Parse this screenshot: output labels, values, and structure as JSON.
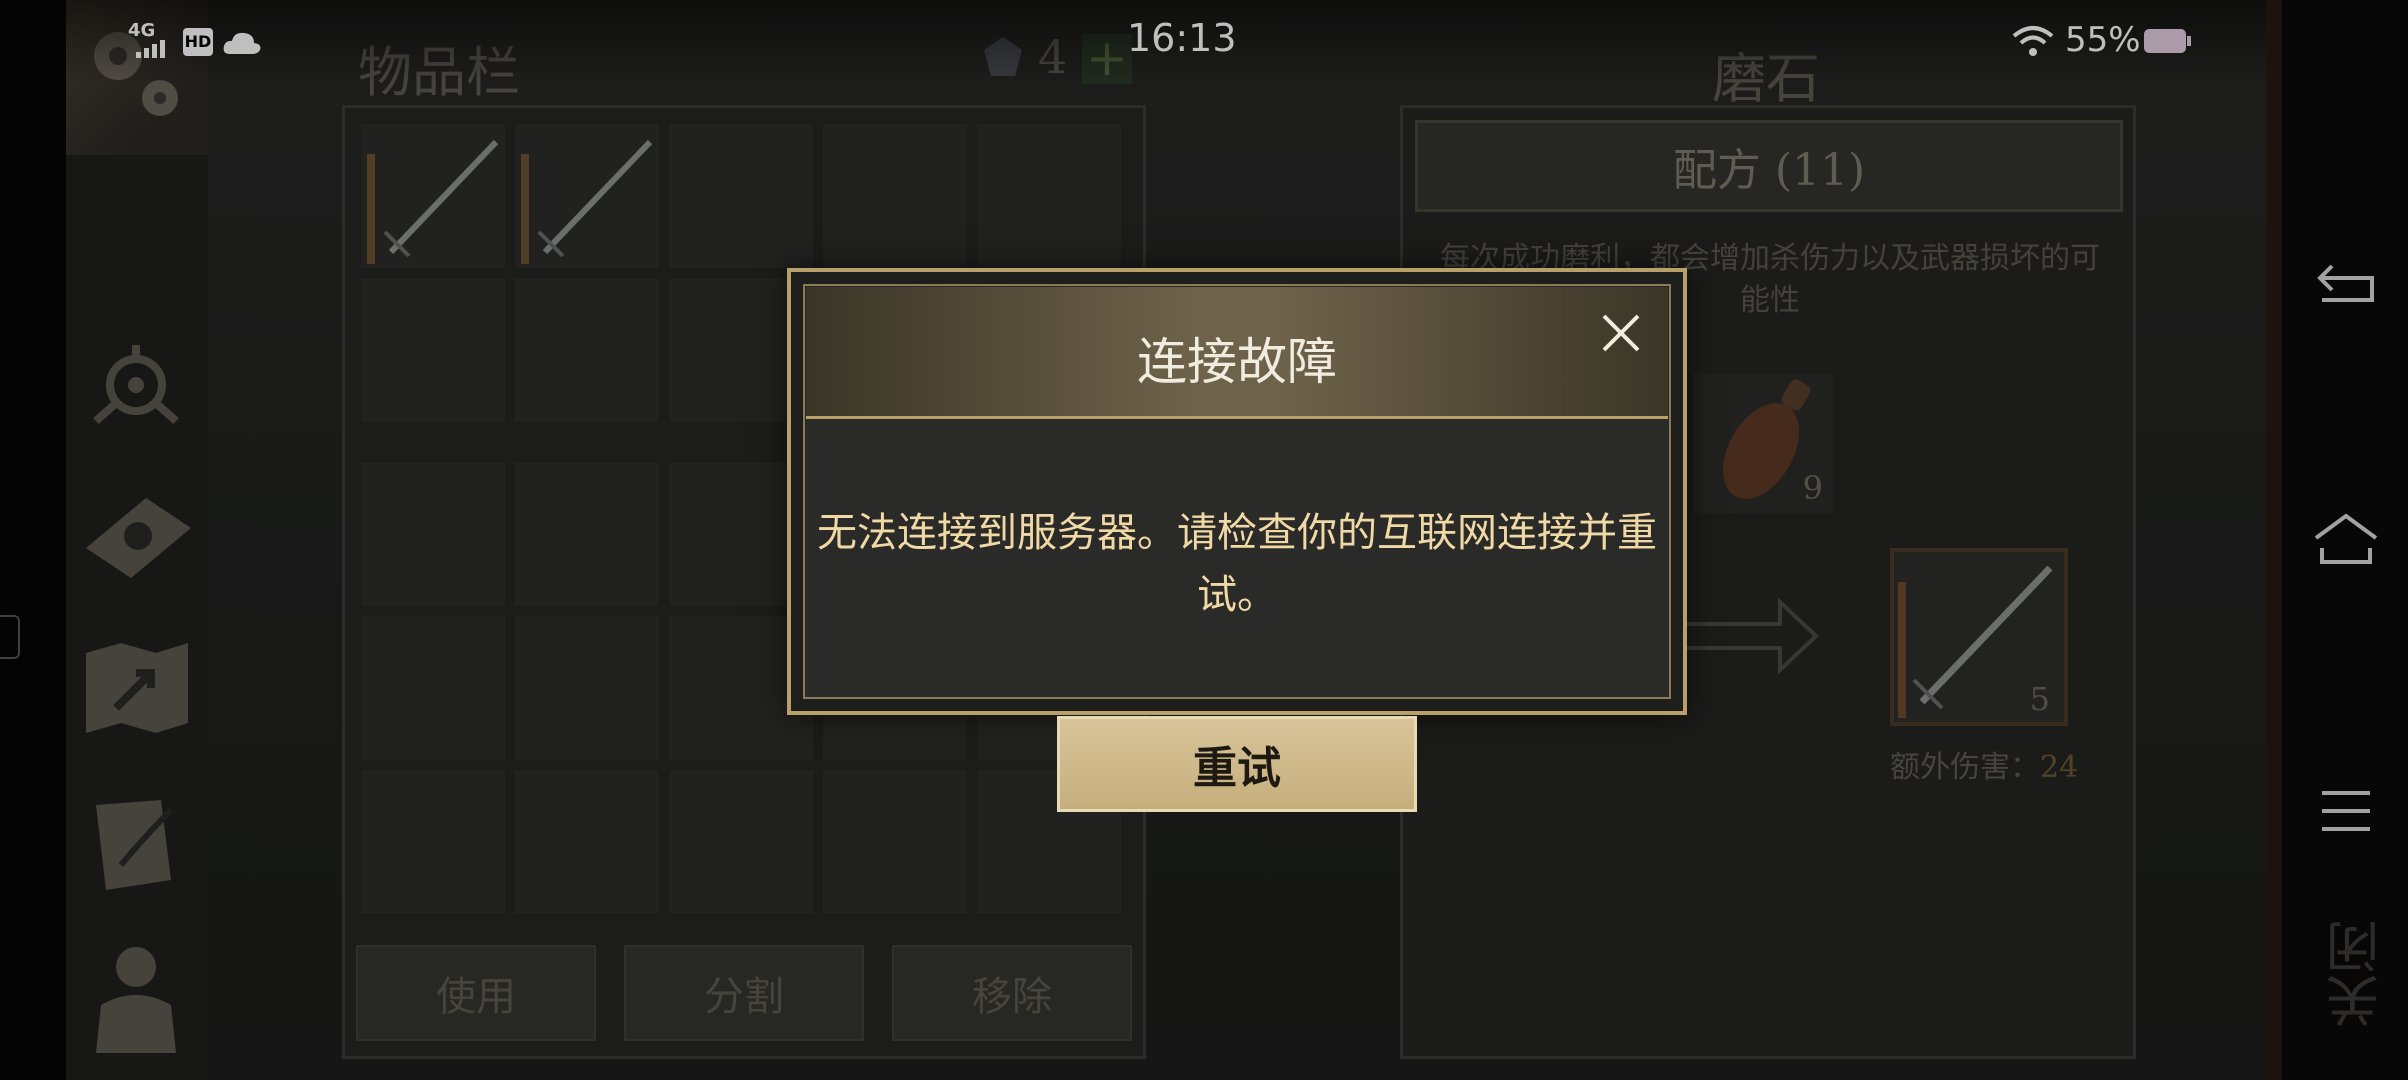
{
  "status_bar": {
    "network": "4G",
    "hd": "HD",
    "time": "16:13",
    "battery": "55%"
  },
  "inventory": {
    "title": "物品栏",
    "gem_count": "4",
    "add_symbol": "+",
    "buttons": {
      "use": "使用",
      "split": "分割",
      "remove": "移除"
    }
  },
  "whetstone": {
    "title": "磨石",
    "recipe_tab": "配方 (11)",
    "description": "每次成功磨利，都会增加杀伤力以及武器损坏的可能性",
    "bottle_count": "9",
    "result_count": "5",
    "extra_damage_label": "额外伤害：",
    "extra_damage_value": "24"
  },
  "dialog": {
    "title": "连接故障",
    "message": "无法连接到服务器。请检查你的互联网连接并重试。",
    "retry_label": "重试"
  },
  "nav": {
    "close_label": "关闭"
  },
  "colors": {
    "dialog_border": "#b8a06a",
    "message_text": "#f1d9a6",
    "retry_bg": "#d8c49a"
  }
}
